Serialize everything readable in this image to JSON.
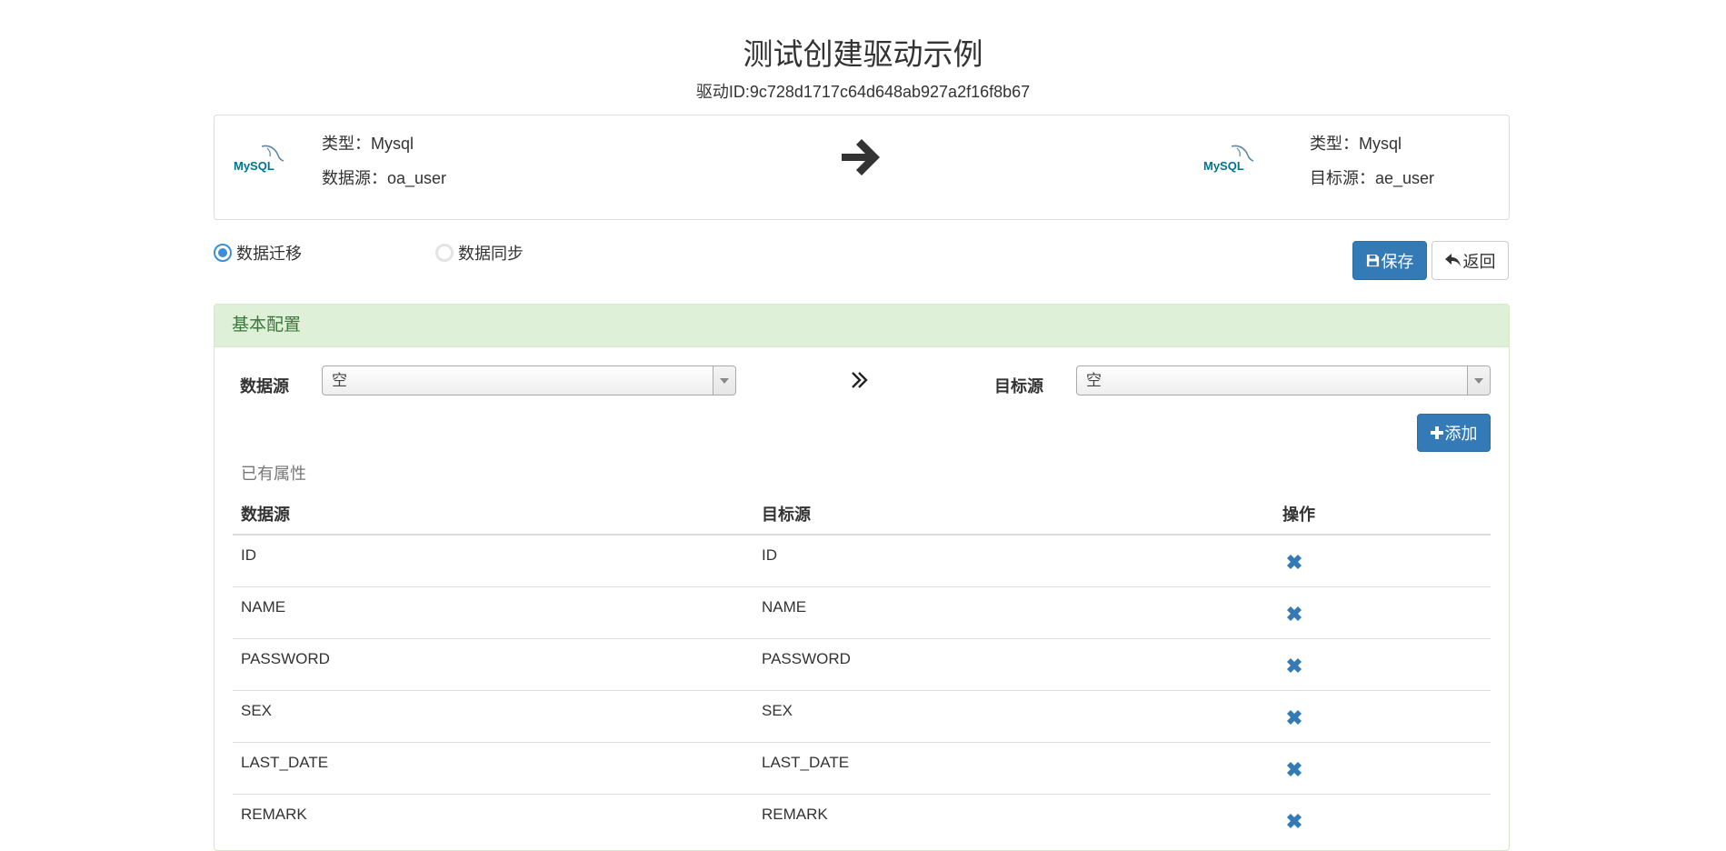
{
  "header": {
    "title": "测试创建驱动示例",
    "driver_id": "驱动ID:9c728d1717c64d648ab927a2f16f8b67"
  },
  "driver": {
    "source": {
      "type_line": "类型：Mysql",
      "name_line": "数据源：oa_user",
      "logo_text": "MySQL"
    },
    "target": {
      "type_line": "类型：Mysql",
      "name_line": "目标源：ae_user",
      "logo_text": "MySQL"
    }
  },
  "mode": {
    "options": [
      {
        "label": "数据迁移",
        "checked": true
      },
      {
        "label": "数据同步",
        "checked": false
      }
    ]
  },
  "toolbar": {
    "save_label": "保存",
    "back_label": "返回"
  },
  "config": {
    "heading": "基本配置",
    "source_label": "数据源",
    "source_value": "空",
    "target_label": "目标源",
    "target_value": "空",
    "add_label": "添加",
    "existing_title": "已有属性",
    "columns": {
      "source": "数据源",
      "target": "目标源",
      "action": "操作"
    },
    "rows": [
      {
        "source": "ID",
        "target": "ID"
      },
      {
        "source": "NAME",
        "target": "NAME"
      },
      {
        "source": "PASSWORD",
        "target": "PASSWORD"
      },
      {
        "source": "SEX",
        "target": "SEX"
      },
      {
        "source": "LAST_DATE",
        "target": "LAST_DATE"
      },
      {
        "source": "REMARK",
        "target": "REMARK"
      }
    ]
  },
  "colors": {
    "primary": "#337ab7",
    "panel_success_bg": "#dff0d8",
    "panel_success_text": "#3c763d",
    "delete_icon": "#337ab7"
  },
  "icons": {
    "arrow": "arrow-right-icon",
    "double_chevron": "double-chevron-right-icon",
    "save": "floppy-disk-icon",
    "back": "share-alt-back-icon",
    "plus": "plus-icon",
    "delete": "remove-icon"
  }
}
